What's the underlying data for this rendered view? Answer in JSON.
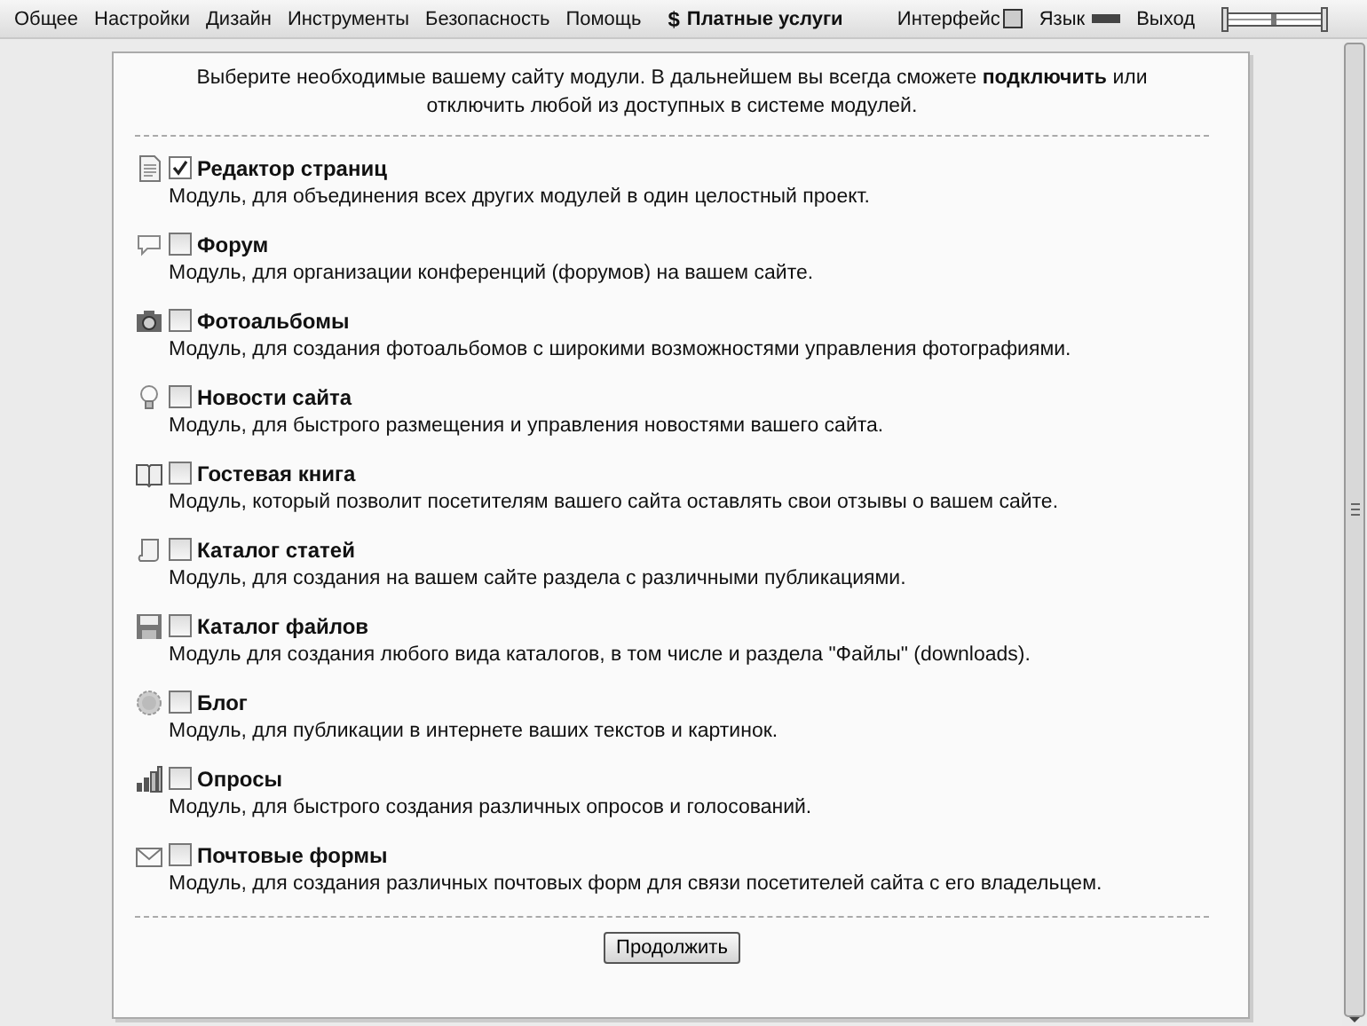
{
  "menu": [
    {
      "label": "Общее"
    },
    {
      "label": "Настройки"
    },
    {
      "label": "Дизайн"
    },
    {
      "label": "Инструменты"
    },
    {
      "label": "Безопасность"
    },
    {
      "label": "Помощь"
    }
  ],
  "paid": {
    "icon": "$",
    "label": "Платные услуги"
  },
  "right_menu": [
    {
      "label": "Интерфейс"
    },
    {
      "label": "Язык"
    },
    {
      "label": "Выход"
    }
  ],
  "intro": "Выберите необходимые вашему сайту модули. В дальнейшем вы всегда сможете **подключить** или отключить любой из доступных в системе модулей.",
  "modules": [
    {
      "name": "Редактор страниц",
      "checked": true,
      "description": "Модуль, для объединения всех других модулей в один целостный проект."
    },
    {
      "name": "Форум",
      "checked": false,
      "description": "Модуль, для организации конференций (форумов) на вашем сайте."
    },
    {
      "name": "Фотоальбомы",
      "checked": false,
      "description": "Модуль, для создания фотоальбомов с широкими возможностями управления фотографиями."
    },
    {
      "name": "Новости сайта",
      "checked": false,
      "description": "Модуль, для быстрого размещения и управления новостями вашего сайта."
    },
    {
      "name": "Гостевая книга",
      "checked": false,
      "description": "Модуль, который позволит посетителям вашего сайта оставлять свои отзывы о вашем сайте."
    },
    {
      "name": "Каталог статей",
      "checked": false,
      "description": "Модуль, для создания на вашем сайте раздела с различными публикациями."
    },
    {
      "name": "Каталог файлов",
      "checked": false,
      "description": "Модуль для создания любого вида каталогов, в том числе и раздела \"Файлы\" (downloads)."
    },
    {
      "name": "Блог",
      "checked": false,
      "description": "Модуль, для публикации в интернете ваших текстов и картинок."
    },
    {
      "name": "Опросы",
      "checked": false,
      "description": "Модуль, для быстрого создания различных опросов и голосований."
    },
    {
      "name": "Почтовые формы",
      "checked": false,
      "description": "Модуль, для создания различных почтовых форм для связи посетителей сайта с его владельцем."
    }
  ],
  "continue_button": "Продолжить"
}
